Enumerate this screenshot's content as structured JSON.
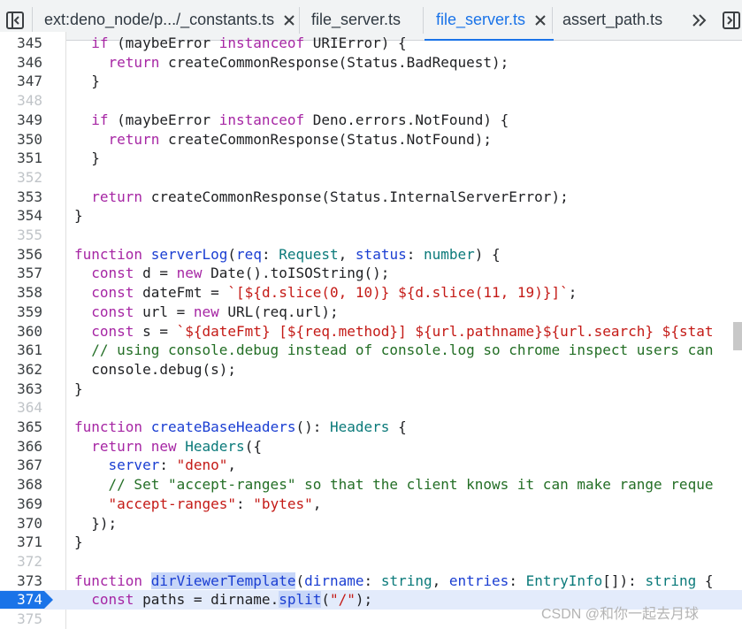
{
  "tabs": [
    {
      "label": "ext:deno_node/p.../_constants.ts",
      "closable": true,
      "active": false
    },
    {
      "label": "file_server.ts",
      "closable": false,
      "active": false
    },
    {
      "label": "file_server.ts",
      "closable": true,
      "active": true
    },
    {
      "label": "assert_path.ts",
      "closable": false,
      "active": false
    }
  ],
  "editor": {
    "lines": [
      {
        "n": "345",
        "code": "  if (maybeError instanceof URIError) {"
      },
      {
        "n": "346",
        "code": "    return createCommonResponse(Status.BadRequest);"
      },
      {
        "n": "347",
        "code": "  }"
      },
      {
        "n": "348",
        "code": ""
      },
      {
        "n": "349",
        "code": "  if (maybeError instanceof Deno.errors.NotFound) {"
      },
      {
        "n": "350",
        "code": "    return createCommonResponse(Status.NotFound);"
      },
      {
        "n": "351",
        "code": "  }"
      },
      {
        "n": "352",
        "code": ""
      },
      {
        "n": "353",
        "code": "  return createCommonResponse(Status.InternalServerError);"
      },
      {
        "n": "354",
        "code": "}"
      },
      {
        "n": "355",
        "code": ""
      },
      {
        "n": "356",
        "code": "function serverLog(req: Request, status: number) {"
      },
      {
        "n": "357",
        "code": "  const d = new Date().toISOString();"
      },
      {
        "n": "358",
        "code": "  const dateFmt = `[${d.slice(0, 10)} ${d.slice(11, 19)}]`;"
      },
      {
        "n": "359",
        "code": "  const url = new URL(req.url);"
      },
      {
        "n": "360",
        "code": "  const s = `${dateFmt} [${req.method}] ${url.pathname}${url.search} ${stat"
      },
      {
        "n": "361",
        "code": "  // using console.debug instead of console.log so chrome inspect users can"
      },
      {
        "n": "362",
        "code": "  console.debug(s);"
      },
      {
        "n": "363",
        "code": "}"
      },
      {
        "n": "364",
        "code": ""
      },
      {
        "n": "365",
        "code": "function createBaseHeaders(): Headers {"
      },
      {
        "n": "366",
        "code": "  return new Headers({"
      },
      {
        "n": "367",
        "code": "    server: \"deno\","
      },
      {
        "n": "368",
        "code": "    // Set \"accept-ranges\" so that the client knows it can make range reque"
      },
      {
        "n": "369",
        "code": "    \"accept-ranges\": \"bytes\","
      },
      {
        "n": "370",
        "code": "  });"
      },
      {
        "n": "371",
        "code": "}"
      },
      {
        "n": "372",
        "code": ""
      },
      {
        "n": "373",
        "code": "function dirViewerTemplate(dirname: string, entries: EntryInfo[]): string {"
      },
      {
        "n": "374",
        "code": "  const paths = dirname.split(\"/\");"
      },
      {
        "n": "375",
        "code": ""
      }
    ],
    "current_line": "374"
  },
  "watermark": "CSDN @和你一起去月球",
  "icons": {
    "sidebar_toggle": "sidebar-toggle-icon",
    "overflow": "chevron-double-right-icon",
    "right_panel_toggle": "right-panel-toggle-icon",
    "close": "close-icon"
  }
}
